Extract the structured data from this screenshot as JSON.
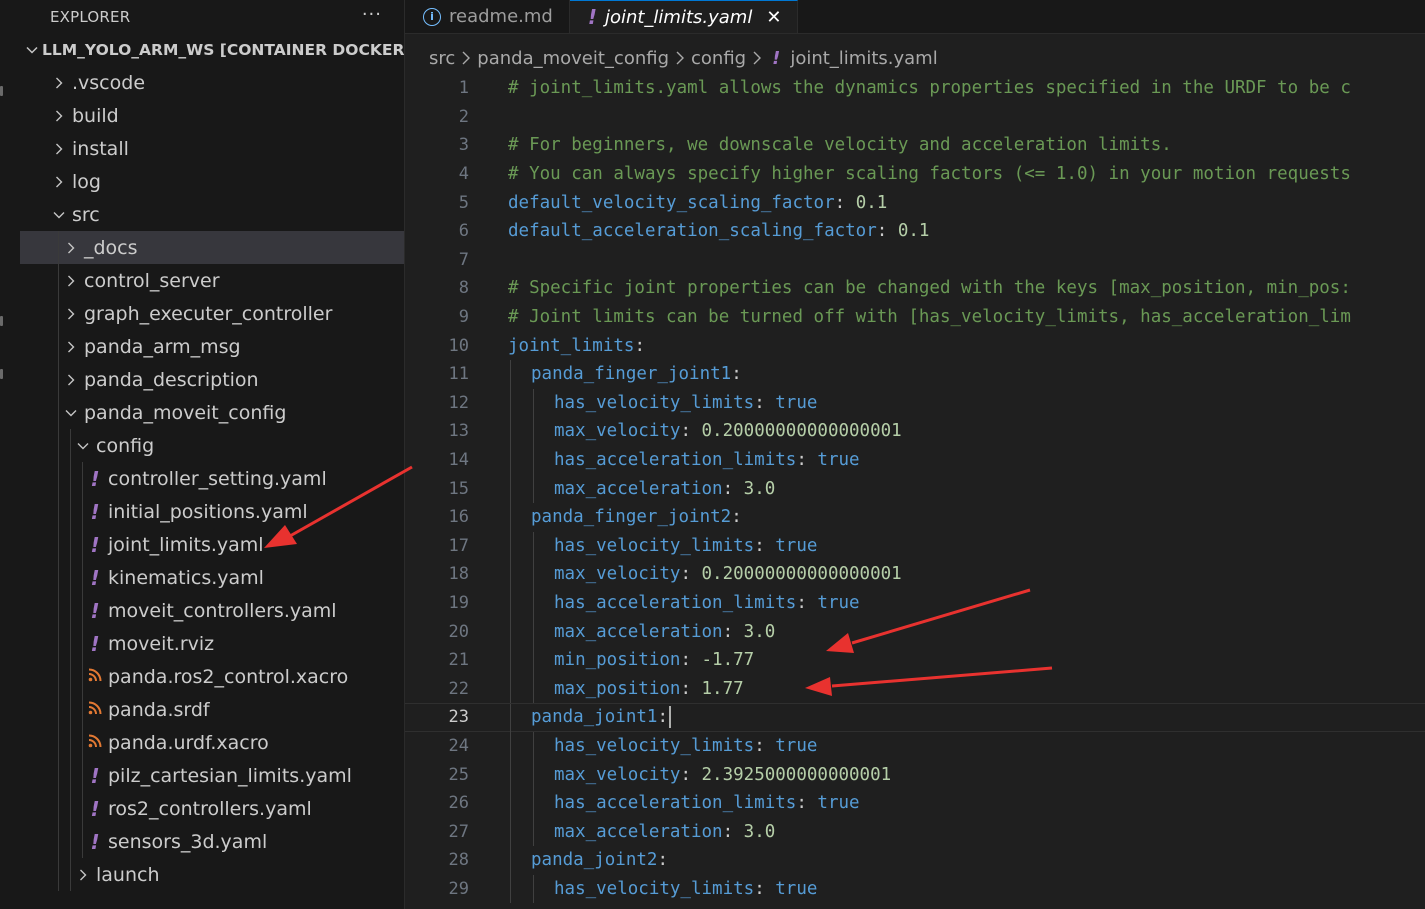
{
  "sidebar": {
    "title": "EXPLORER",
    "more_label": "···",
    "workspace": "LLM_YOLO_ARM_WS [CONTAINER DOCKER....",
    "items": [
      {
        "label": ".vscode",
        "type": "folder",
        "expanded": false,
        "depth": 1
      },
      {
        "label": "build",
        "type": "folder",
        "expanded": false,
        "depth": 1
      },
      {
        "label": "install",
        "type": "folder",
        "expanded": false,
        "depth": 1
      },
      {
        "label": "log",
        "type": "folder",
        "expanded": false,
        "depth": 1
      },
      {
        "label": "src",
        "type": "folder",
        "expanded": true,
        "depth": 1
      },
      {
        "label": "_docs",
        "type": "folder",
        "expanded": false,
        "depth": 2,
        "selected": true
      },
      {
        "label": "control_server",
        "type": "folder",
        "expanded": false,
        "depth": 2
      },
      {
        "label": "graph_executer_controller",
        "type": "folder",
        "expanded": false,
        "depth": 2
      },
      {
        "label": "panda_arm_msg",
        "type": "folder",
        "expanded": false,
        "depth": 2
      },
      {
        "label": "panda_description",
        "type": "folder",
        "expanded": false,
        "depth": 2
      },
      {
        "label": "panda_moveit_config",
        "type": "folder",
        "expanded": true,
        "depth": 2
      },
      {
        "label": "config",
        "type": "folder",
        "expanded": true,
        "depth": 3
      },
      {
        "label": "controller_setting.yaml",
        "type": "yaml",
        "depth": 4
      },
      {
        "label": "initial_positions.yaml",
        "type": "yaml",
        "depth": 4
      },
      {
        "label": "joint_limits.yaml",
        "type": "yaml",
        "depth": 4
      },
      {
        "label": "kinematics.yaml",
        "type": "yaml",
        "depth": 4
      },
      {
        "label": "moveit_controllers.yaml",
        "type": "yaml",
        "depth": 4
      },
      {
        "label": "moveit.rviz",
        "type": "yaml",
        "depth": 4
      },
      {
        "label": "panda.ros2_control.xacro",
        "type": "xml",
        "depth": 4
      },
      {
        "label": "panda.srdf",
        "type": "xml",
        "depth": 4
      },
      {
        "label": "panda.urdf.xacro",
        "type": "xml",
        "depth": 4
      },
      {
        "label": "pilz_cartesian_limits.yaml",
        "type": "yaml",
        "depth": 4
      },
      {
        "label": "ros2_controllers.yaml",
        "type": "yaml",
        "depth": 4
      },
      {
        "label": "sensors_3d.yaml",
        "type": "yaml",
        "depth": 4
      },
      {
        "label": "launch",
        "type": "folder",
        "expanded": false,
        "depth": 3
      }
    ]
  },
  "tabs": [
    {
      "label": "readme.md",
      "icon": "info-icon",
      "active": false
    },
    {
      "label": "joint_limits.yaml",
      "icon": "yaml-icon",
      "active": true,
      "close": "✕"
    }
  ],
  "breadcrumb": [
    "src",
    "panda_moveit_config",
    "config",
    "joint_limits.yaml"
  ],
  "editor": {
    "current_line": 23,
    "lines": [
      {
        "n": "1",
        "indent": 0,
        "tokens": [
          [
            "cm",
            "# joint_limits.yaml allows the dynamics properties specified in the URDF to be c"
          ]
        ]
      },
      {
        "n": "2",
        "indent": 0,
        "tokens": []
      },
      {
        "n": "3",
        "indent": 0,
        "tokens": [
          [
            "cm",
            "# For beginners, we downscale velocity and acceleration limits."
          ]
        ]
      },
      {
        "n": "4",
        "indent": 0,
        "tokens": [
          [
            "cm",
            "# You can always specify higher scaling factors (<= 1.0) in your motion requests"
          ]
        ]
      },
      {
        "n": "5",
        "indent": 0,
        "tokens": [
          [
            "key",
            "default_velocity_scaling_factor"
          ],
          [
            "punc",
            ": "
          ],
          [
            "num",
            "0.1"
          ]
        ]
      },
      {
        "n": "6",
        "indent": 0,
        "tokens": [
          [
            "key",
            "default_acceleration_scaling_factor"
          ],
          [
            "punc",
            ": "
          ],
          [
            "num",
            "0.1"
          ]
        ]
      },
      {
        "n": "7",
        "indent": 0,
        "tokens": []
      },
      {
        "n": "8",
        "indent": 0,
        "tokens": [
          [
            "cm",
            "# Specific joint properties can be changed with the keys [max_position, min_pos:"
          ]
        ]
      },
      {
        "n": "9",
        "indent": 0,
        "tokens": [
          [
            "cm",
            "# Joint limits can be turned off with [has_velocity_limits, has_acceleration_lim"
          ]
        ]
      },
      {
        "n": "10",
        "indent": 0,
        "tokens": [
          [
            "key",
            "joint_limits"
          ],
          [
            "punc",
            ":"
          ]
        ]
      },
      {
        "n": "11",
        "indent": 1,
        "tokens": [
          [
            "key",
            "panda_finger_joint1"
          ],
          [
            "punc",
            ":"
          ]
        ]
      },
      {
        "n": "12",
        "indent": 2,
        "tokens": [
          [
            "key",
            "has_velocity_limits"
          ],
          [
            "punc",
            ": "
          ],
          [
            "bool",
            "true"
          ]
        ]
      },
      {
        "n": "13",
        "indent": 2,
        "tokens": [
          [
            "key",
            "max_velocity"
          ],
          [
            "punc",
            ": "
          ],
          [
            "num",
            "0.20000000000000001"
          ]
        ]
      },
      {
        "n": "14",
        "indent": 2,
        "tokens": [
          [
            "key",
            "has_acceleration_limits"
          ],
          [
            "punc",
            ": "
          ],
          [
            "bool",
            "true"
          ]
        ]
      },
      {
        "n": "15",
        "indent": 2,
        "tokens": [
          [
            "key",
            "max_acceleration"
          ],
          [
            "punc",
            ": "
          ],
          [
            "num",
            "3.0"
          ]
        ]
      },
      {
        "n": "16",
        "indent": 1,
        "tokens": [
          [
            "key",
            "panda_finger_joint2"
          ],
          [
            "punc",
            ":"
          ]
        ]
      },
      {
        "n": "17",
        "indent": 2,
        "tokens": [
          [
            "key",
            "has_velocity_limits"
          ],
          [
            "punc",
            ": "
          ],
          [
            "bool",
            "true"
          ]
        ]
      },
      {
        "n": "18",
        "indent": 2,
        "tokens": [
          [
            "key",
            "max_velocity"
          ],
          [
            "punc",
            ": "
          ],
          [
            "num",
            "0.20000000000000001"
          ]
        ]
      },
      {
        "n": "19",
        "indent": 2,
        "tokens": [
          [
            "key",
            "has_acceleration_limits"
          ],
          [
            "punc",
            ": "
          ],
          [
            "bool",
            "true"
          ]
        ]
      },
      {
        "n": "20",
        "indent": 2,
        "tokens": [
          [
            "key",
            "max_acceleration"
          ],
          [
            "punc",
            ": "
          ],
          [
            "num",
            "3.0"
          ]
        ]
      },
      {
        "n": "21",
        "indent": 2,
        "tokens": [
          [
            "key",
            "min_position"
          ],
          [
            "punc",
            ": "
          ],
          [
            "num",
            "-1.77"
          ]
        ]
      },
      {
        "n": "22",
        "indent": 2,
        "tokens": [
          [
            "key",
            "max_position"
          ],
          [
            "punc",
            ": "
          ],
          [
            "num",
            "1.77"
          ]
        ]
      },
      {
        "n": "23",
        "indent": 1,
        "tokens": [
          [
            "key",
            "panda_joint1"
          ],
          [
            "punc",
            ":"
          ]
        ]
      },
      {
        "n": "24",
        "indent": 2,
        "tokens": [
          [
            "key",
            "has_velocity_limits"
          ],
          [
            "punc",
            ": "
          ],
          [
            "bool",
            "true"
          ]
        ]
      },
      {
        "n": "25",
        "indent": 2,
        "tokens": [
          [
            "key",
            "max_velocity"
          ],
          [
            "punc",
            ": "
          ],
          [
            "num",
            "2.3925000000000001"
          ]
        ]
      },
      {
        "n": "26",
        "indent": 2,
        "tokens": [
          [
            "key",
            "has_acceleration_limits"
          ],
          [
            "punc",
            ": "
          ],
          [
            "bool",
            "true"
          ]
        ]
      },
      {
        "n": "27",
        "indent": 2,
        "tokens": [
          [
            "key",
            "max_acceleration"
          ],
          [
            "punc",
            ": "
          ],
          [
            "num",
            "3.0"
          ]
        ]
      },
      {
        "n": "28",
        "indent": 1,
        "tokens": [
          [
            "key",
            "panda_joint2"
          ],
          [
            "punc",
            ":"
          ]
        ]
      },
      {
        "n": "29",
        "indent": 2,
        "tokens": [
          [
            "key",
            "has_velocity_limits"
          ],
          [
            "punc",
            ": "
          ],
          [
            "bool",
            "true"
          ]
        ]
      }
    ]
  },
  "colors": {
    "annotation_arrow": "#e8322f",
    "accent": "#0078d4",
    "yaml_icon": "#a074c4"
  }
}
